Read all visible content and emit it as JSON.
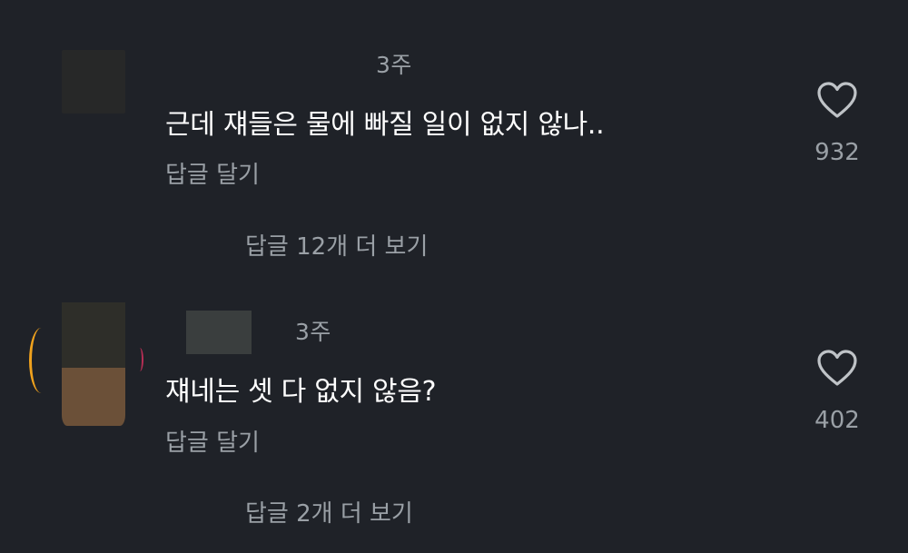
{
  "comments": [
    {
      "time": "3주",
      "text": "근데 쟤들은 물에 빠질 일이 없지 않나..",
      "reply_label": "답글 달기",
      "likes": "932",
      "view_replies": "답글 12개 더 보기"
    },
    {
      "time": "3주",
      "text": "쟤네는 셋 다 없지 않음?",
      "reply_label": "답글 달기",
      "likes": "402",
      "view_replies": "답글 2개 더 보기"
    }
  ],
  "icons": {
    "like": "heart-outline-icon"
  },
  "colors": {
    "background": "#1f2228",
    "primary_text": "#ffffff",
    "secondary_text": "#9aa0a6",
    "story_ring_orange": "#f0a21d",
    "story_ring_pink": "#b72e55"
  }
}
